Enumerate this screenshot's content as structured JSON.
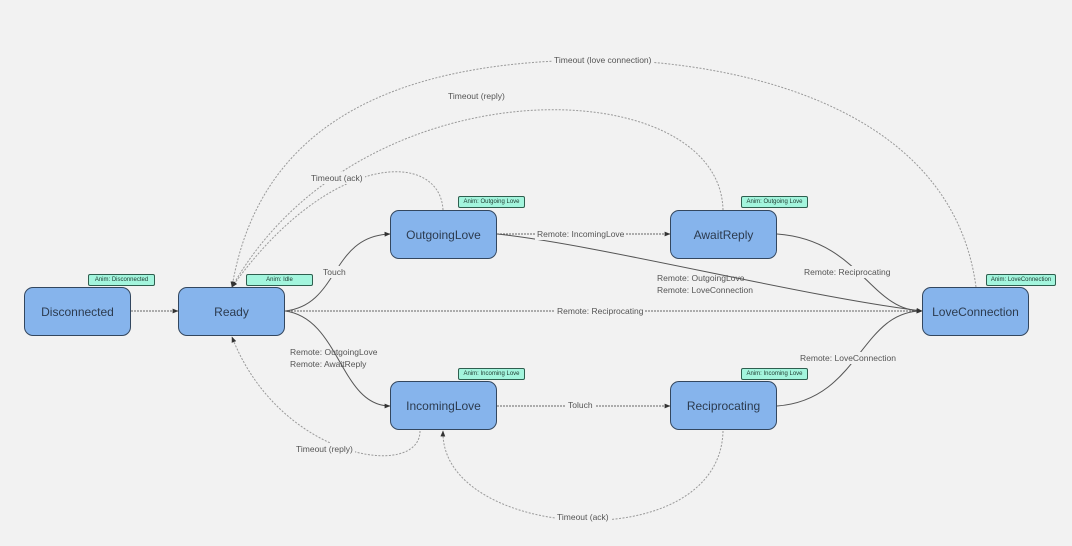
{
  "diagram": {
    "states": [
      {
        "id": "disconnected",
        "label": "Disconnected",
        "anim": "Anim: Disconnected"
      },
      {
        "id": "ready",
        "label": "Ready",
        "anim": "Anim: Idle"
      },
      {
        "id": "outgoing_love",
        "label": "OutgoingLove",
        "anim": "Anim: Outgoing Love"
      },
      {
        "id": "await_reply",
        "label": "AwaitReply",
        "anim": "Anim: Outgoing Love"
      },
      {
        "id": "love_connection",
        "label": "LoveConnection",
        "anim": "Anim: LoveConnection"
      },
      {
        "id": "incoming_love",
        "label": "IncomingLove",
        "anim": "Anim: Incoming Love"
      },
      {
        "id": "reciprocating",
        "label": "Reciprocating",
        "anim": "Anim: Incoming Love"
      }
    ],
    "transitions": [
      {
        "from": "disconnected",
        "to": "ready",
        "label": ""
      },
      {
        "from": "ready",
        "to": "outgoing_love",
        "label": "Touch"
      },
      {
        "from": "ready",
        "to": "incoming_love",
        "label": "Remote: OutgoingLove\nRemote: AwaitReply"
      },
      {
        "from": "ready",
        "to": "love_connection",
        "label": "Remote: Reciprocating"
      },
      {
        "from": "outgoing_love",
        "to": "await_reply",
        "label": "Remote: IncomingLove"
      },
      {
        "from": "outgoing_love",
        "to": "love_connection",
        "label": "Remote: OutgoingLove\nRemote: LoveConnection"
      },
      {
        "from": "await_reply",
        "to": "love_connection",
        "label": "Remote: Reciprocating"
      },
      {
        "from": "incoming_love",
        "to": "reciprocating",
        "label": "Toluch"
      },
      {
        "from": "reciprocating",
        "to": "love_connection",
        "label": "Remote: LoveConnection"
      },
      {
        "from": "outgoing_love",
        "to": "ready",
        "label": "Timeout (ack)"
      },
      {
        "from": "await_reply",
        "to": "ready",
        "label": "Timeout (reply)"
      },
      {
        "from": "love_connection",
        "to": "ready",
        "label": "Timeout (love connection)"
      },
      {
        "from": "incoming_love",
        "to": "ready",
        "label": "Timeout (reply)"
      },
      {
        "from": "reciprocating",
        "to": "incoming_love",
        "label": "Timeout (ack)"
      }
    ],
    "colors": {
      "background": "#f2f2f2",
      "state_fill": "#86b4ec",
      "state_border": "#33475f",
      "anim_tag_fill": "#a3f5dd"
    }
  }
}
